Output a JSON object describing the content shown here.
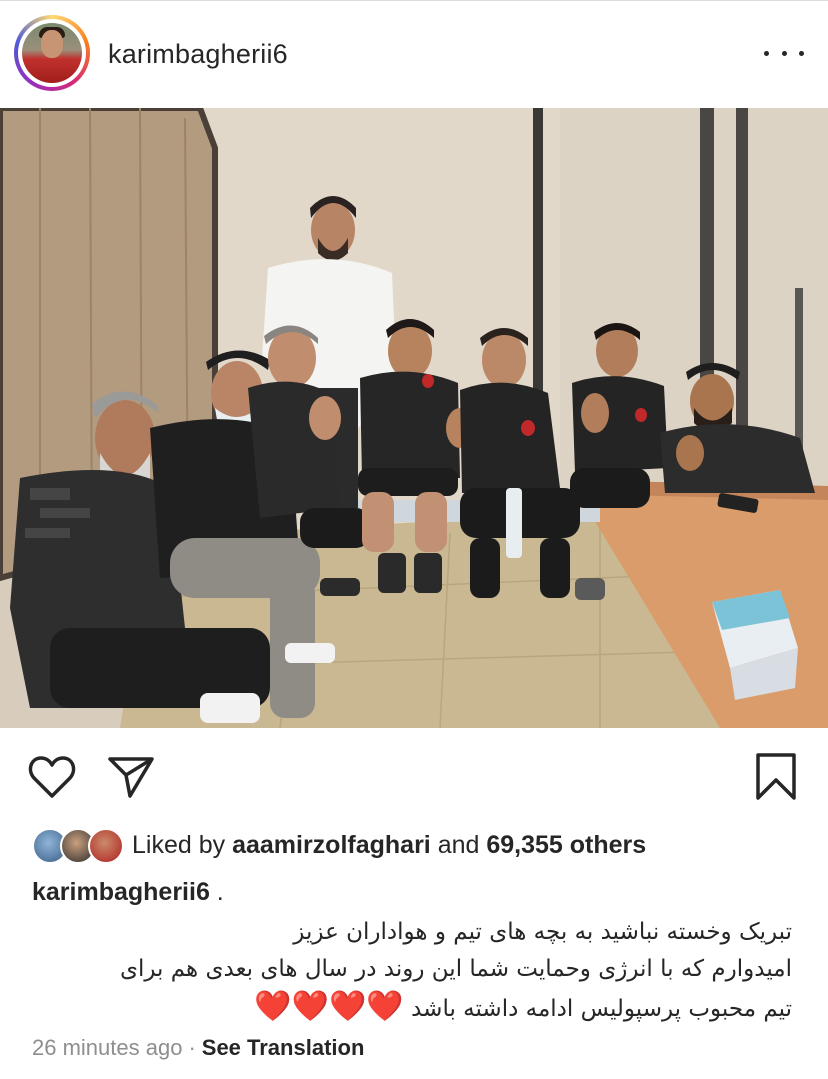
{
  "post": {
    "username": "karimbagherii6",
    "more_icon": "more-horizontal-icon"
  },
  "actions": {
    "like_icon": "heart-outline-icon",
    "share_icon": "paper-plane-icon",
    "save_icon": "bookmark-icon"
  },
  "likes": {
    "prefix": "Liked by ",
    "liker": "aaamirzolfaghari",
    "middle": " and ",
    "count": "69,355 others"
  },
  "caption": {
    "username": "karimbagherii6",
    "suffix": " .",
    "line1": "تبریک وخسته نباشید به بچه های تیم و هواداران عزیز",
    "line2": "امیدوارم که با انرژی وحمایت شما این روند در سال های بعدی هم برای",
    "line3": "تیم محبوب پرسپولیس ادامه داشته باشد",
    "hearts": "❤️❤️❤️❤️"
  },
  "meta": {
    "time": "26 minutes ago",
    "separator": "·",
    "see_translation": "See Translation"
  }
}
